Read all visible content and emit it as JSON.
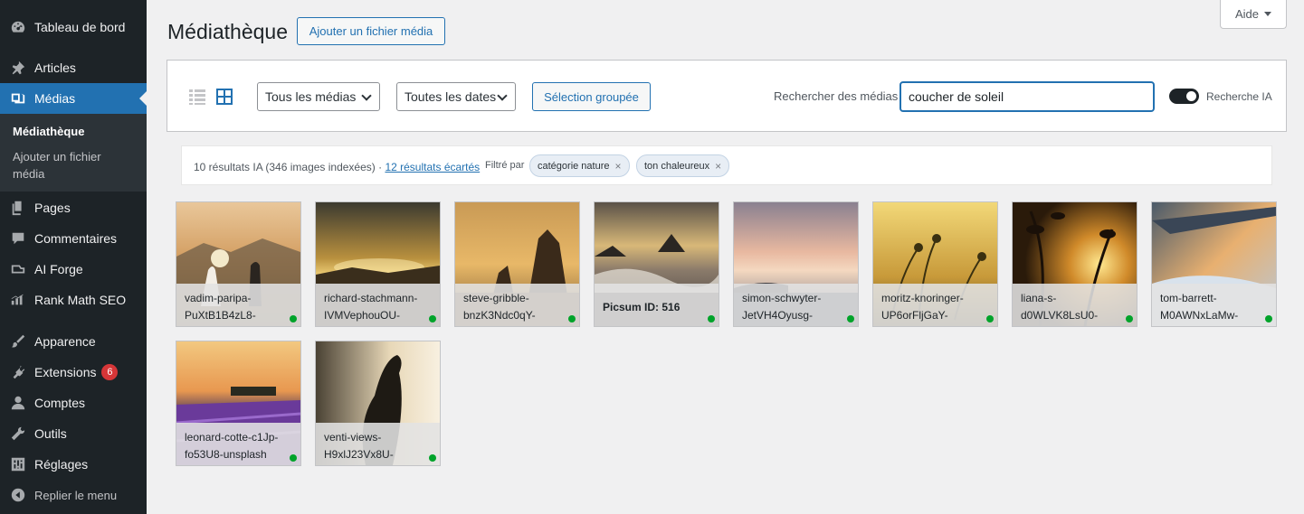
{
  "sidebar": {
    "items": [
      {
        "label": "Tableau de bord",
        "icon": "dashboard-icon"
      },
      {
        "label": "Articles",
        "icon": "pin-icon"
      },
      {
        "label": "Médias",
        "icon": "media-icon"
      },
      {
        "label": "Pages",
        "icon": "pages-icon"
      },
      {
        "label": "Commentaires",
        "icon": "comment-icon"
      },
      {
        "label": "AI Forge",
        "icon": "ai-forge-icon"
      },
      {
        "label": "Rank Math SEO",
        "icon": "chart-icon"
      },
      {
        "label": "Apparence",
        "icon": "brush-icon"
      },
      {
        "label": "Extensions",
        "icon": "plugin-icon",
        "badge": "6"
      },
      {
        "label": "Comptes",
        "icon": "user-icon"
      },
      {
        "label": "Outils",
        "icon": "wrench-icon"
      },
      {
        "label": "Réglages",
        "icon": "settings-icon"
      }
    ],
    "submenu": {
      "current": "Médiathèque",
      "add": "Ajouter un fichier média"
    },
    "collapse_label": "Replier le menu"
  },
  "header": {
    "title": "Médiathèque",
    "add_button": "Ajouter un fichier média",
    "help": "Aide"
  },
  "toolbar": {
    "type_filter": "Tous les médias",
    "date_filter": "Toutes les dates",
    "bulk_select": "Sélection groupée",
    "search_label": "Rechercher des médias",
    "search_value": "coucher de soleil",
    "toggle_label": "Recherche IA",
    "toggle_on": true
  },
  "results": {
    "summary": "10 résultats IA (346 images indexées) · ",
    "discarded_link": "12 résultats écartés",
    "filtered_by": "Filtré par",
    "chips": [
      {
        "label": "catégorie nature",
        "remove": "×"
      },
      {
        "label": "ton chaleureux",
        "remove": "×"
      }
    ]
  },
  "media": [
    {
      "line1": "vadim-paripa-",
      "line2": "PuXtB1B4zL8-",
      "status": "indexed"
    },
    {
      "line1": "richard-stachmann-",
      "line2": "IVMVephouOU-",
      "status": "indexed"
    },
    {
      "line1": "steve-gribble-",
      "line2": "bnzK3Ndc0qY-",
      "status": "indexed"
    },
    {
      "line1": "Picsum ID: 516",
      "line2": "",
      "status": "indexed"
    },
    {
      "line1": "simon-schwyter-",
      "line2": "JetVH4Oyusg-",
      "status": "indexed"
    },
    {
      "line1": "moritz-knoringer-",
      "line2": "UP6orFljGaY-",
      "status": "indexed"
    },
    {
      "line1": "liana-s-",
      "line2": "d0WLVK8LsU0-",
      "status": "indexed"
    },
    {
      "line1": "tom-barrett-",
      "line2": "M0AWNxLaMw-",
      "status": "indexed"
    },
    {
      "line1": "leonard-cotte-c1Jp-",
      "line2": "fo53U8-unsplash",
      "status": "indexed"
    },
    {
      "line1": "venti-views-",
      "line2": "H9xlJ23Vx8U-",
      "status": "indexed"
    }
  ],
  "colors": {
    "accent": "#2271b1",
    "sidebar": "#1d2327",
    "indexed": "#00a32a",
    "badge": "#d63638"
  }
}
